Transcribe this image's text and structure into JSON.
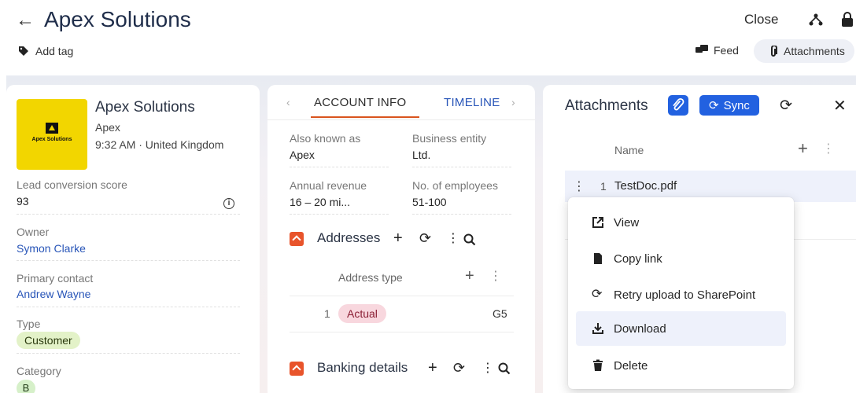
{
  "header": {
    "title": "Apex Solutions",
    "close_label": "Close",
    "add_tag_label": "Add tag",
    "feed_label": "Feed",
    "attachments_label": "Attachments"
  },
  "profile": {
    "name": "Apex Solutions",
    "short_name": "Apex",
    "local_time": "9:32 AM · United Kingdom",
    "logo_text": "Apex Solutions",
    "fields": {
      "lead_score_label": "Lead conversion score",
      "lead_score_value": "93",
      "owner_label": "Owner",
      "owner_value": "Symon Clarke",
      "primary_contact_label": "Primary contact",
      "primary_contact_value": "Andrew Wayne",
      "type_label": "Type",
      "type_value": "Customer",
      "category_label": "Category",
      "category_value": "B"
    }
  },
  "account_info": {
    "tabs": [
      "ACCOUNT INFO",
      "TIMELINE"
    ],
    "also_known_as_label": "Also known as",
    "also_known_as_value": "Apex",
    "business_entity_label": "Business entity",
    "business_entity_value": "Ltd.",
    "annual_revenue_label": "Annual revenue",
    "annual_revenue_value": "16 – 20 mi...",
    "employees_label": "No. of employees",
    "employees_value": "51-100",
    "addresses": {
      "title": "Addresses",
      "column": "Address type",
      "rows": [
        {
          "num": "1",
          "type": "Actual",
          "extra": "G5"
        }
      ]
    },
    "banking_title": "Banking details"
  },
  "attachments": {
    "title": "Attachments",
    "sync_label": "Sync",
    "column_name": "Name",
    "files": [
      {
        "num": "1",
        "name": "TestDoc.pdf"
      }
    ]
  },
  "context_menu": {
    "items": [
      "View",
      "Copy link",
      "Retry upload to SharePoint",
      "Download",
      "Delete"
    ],
    "hovered": "Download"
  },
  "colors": {
    "primary": "#2261e0",
    "accent": "#e8542b",
    "link": "#2855b8"
  }
}
